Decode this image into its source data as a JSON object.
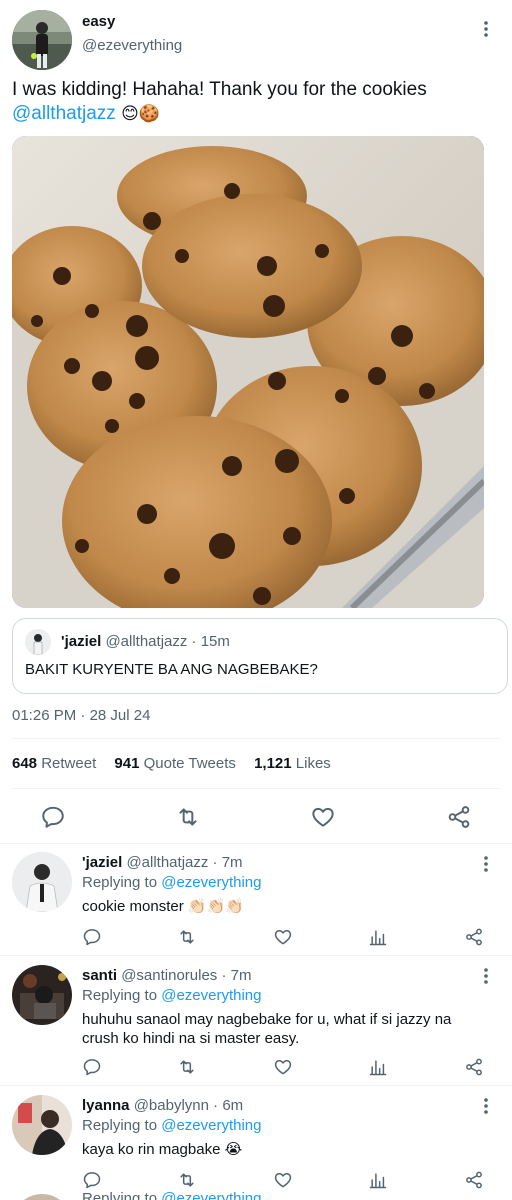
{
  "tweet": {
    "name": "easy",
    "handle": "@ezeverything",
    "text": "I was kidding! Hahaha! Thank you for the cookies",
    "mention": "@allthatjazz",
    "emoji": "😊🍪",
    "time": "01:26 PM",
    "date": "28 Jul 24",
    "date_sep": "·"
  },
  "quoted": {
    "name": "'jaziel",
    "handle": "@allthatjazz",
    "time": "15m",
    "text": "BAKIT KURYENTE BA ANG NAGBEBAKE?"
  },
  "stats": {
    "retweets": "648",
    "retweets_label": "Retweet",
    "quotes": "941",
    "quotes_label": "Quote Tweets",
    "likes": "1,121",
    "likes_label": "Likes"
  },
  "replies": [
    {
      "name": "'jaziel",
      "handle": "@allthatjazz",
      "time": "7m",
      "replying_label": "Replying to",
      "replying_to": "@ezeverything",
      "text": "cookie monster 👏🏻👏🏻👏🏻"
    },
    {
      "name": "santi",
      "handle": "@santinorules",
      "time": "7m",
      "replying_label": "Replying to",
      "replying_to": "@ezeverything",
      "text": "huhuhu sanaol may nagbebake for u, what if si jazzy na crush ko hindi na si master easy."
    },
    {
      "name": "lyanna",
      "handle": "@babylynn",
      "time": "6m",
      "replying_label": "Replying to",
      "replying_to": "@ezeverything",
      "text": "kaya ko rin magbake 😭"
    },
    {
      "replying_label": "Replying to",
      "replying_to": "@ezeverything"
    }
  ],
  "colors": {
    "accent": "#1d9bf0",
    "muted": "#536471",
    "text": "#0f1419",
    "border": "#cfd9de"
  },
  "icons": [
    "more-vertical-icon",
    "reply-icon",
    "retweet-icon",
    "like-icon",
    "share-icon",
    "views-icon"
  ]
}
